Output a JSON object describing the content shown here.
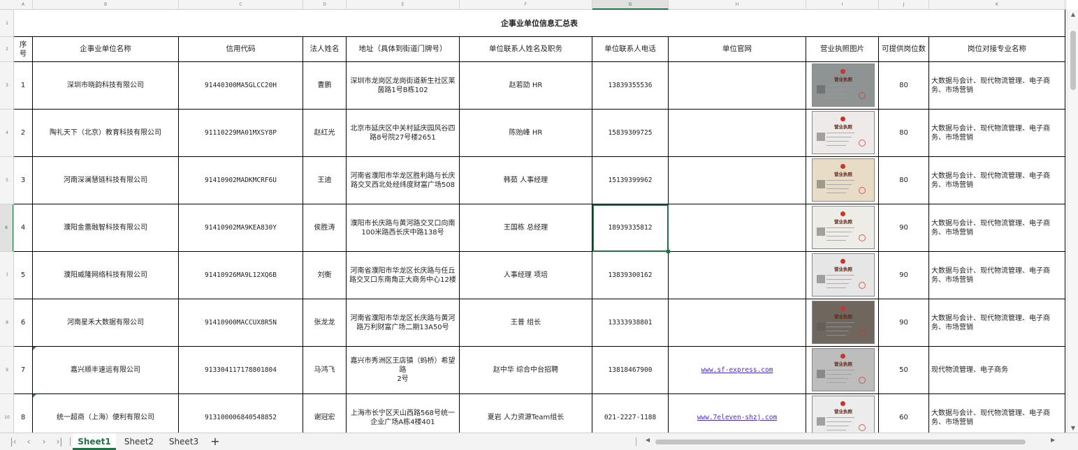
{
  "columns": [
    "A",
    "B",
    "C",
    "D",
    "E",
    "F",
    "G",
    "H",
    "I",
    "J",
    "K"
  ],
  "selected_column": "G",
  "selected_row": "6",
  "title": "企事业单位信息汇总表",
  "headers": [
    "序号",
    "企事业单位名称",
    "信用代码",
    "法人姓名",
    "地址（具体到街道门牌号）",
    "单位联系人姓名及职务",
    "单位联系人电话",
    "单位官网",
    "营业执照图片",
    "可提供岗位数",
    "岗位对接专业名称"
  ],
  "rows": [
    {
      "row": "3",
      "no": "1",
      "name": "深圳市晓韵科技有限公司",
      "code": "91440300MA5GLCC20H",
      "legal": "曹鹏",
      "address": "深圳市龙岗区龙岗街道新生社区莱茵路1号B栋102",
      "contact": "赵若劭  HR",
      "phone": "13839355536",
      "site": "",
      "license_caption": "营业执照",
      "jobs": "80",
      "majors": "大数据与会计、现代物流管理、电子商务、市场营销"
    },
    {
      "row": "4",
      "no": "2",
      "name": "陶礼天下（北京）教育科技有限公司",
      "code": "91110229MA01MXSY8P",
      "legal": "赵红光",
      "address": "北京市延庆区中关村延庆园风谷四路8号院27号楼2651",
      "contact": "陈贻峰  HR",
      "phone": "15839309725",
      "site": "",
      "license_caption": "营业执照",
      "jobs": "80",
      "majors": "大数据与会计、现代物流管理、电子商务、市场营销"
    },
    {
      "row": "5",
      "no": "3",
      "name": "河南深澜慧链科技有限公司",
      "code": "91410902MADKMCRF6U",
      "legal": "王迪",
      "address": "河南省濮阳市华龙区胜利路与长庆路交叉西北处经纬度财富广场508",
      "contact": "韩茹  人事经理",
      "phone": "15139399962",
      "site": "",
      "license_caption": "营业执照",
      "jobs": "80",
      "majors": "大数据与会计、现代物流管理、电子商务、市场营销"
    },
    {
      "row": "6",
      "no": "4",
      "name": "濮阳金蕾融智科技有限公司",
      "code": "91410902MA9KEA830Y",
      "legal": "侯胜涛",
      "address": "濮阳市长庆路与黄河路交叉口向南100米路西长庆中路138号",
      "contact": "王国栋  总经理",
      "phone": "18939335812",
      "site": "",
      "license_caption": "营业执照",
      "jobs": "90",
      "majors": "大数据与会计、现代物流管理、电子商务、市场营销"
    },
    {
      "row": "7",
      "no": "5",
      "name": "濮阳威隆网络科技有限公司",
      "code": "91410926MA9L12XQ6B",
      "legal": "刘衡",
      "address": "河南省濮阳市华龙区长庆路与任丘路交叉口东南角正大商务中心12楼",
      "contact": "人事经理  项培",
      "phone": "13839300162",
      "site": "",
      "license_caption": "营业执照",
      "jobs": "90",
      "majors": "大数据与会计、现代物流管理、电子商务、市场营销"
    },
    {
      "row": "8",
      "no": "6",
      "name": "河南星禾大数据有限公司",
      "code": "91410900MACCUX8R5N",
      "legal": "张龙龙",
      "address": "河南省濮阳市华龙区长庆路与黄河路万利财富广场二期13A50号",
      "contact": "王普  组长",
      "phone": "13333938801",
      "site": "",
      "license_caption": "营业执照",
      "jobs": "90",
      "majors": "大数据与会计、现代物流管理、电子商务、市场营销"
    },
    {
      "row": "9",
      "no": "7",
      "name": "嘉兴顺丰速运有限公司",
      "code": "913304117178801804",
      "legal": "马鸿飞",
      "address": "嘉兴市秀洲区王店镇（蚂桥）希望路\n2号",
      "contact": "赵中华  综合中台招聘",
      "phone": "13818467900",
      "site": "www.sf-express.com",
      "license_caption": "营业执照",
      "jobs": "50",
      "majors": "现代物流管理、电子商务"
    },
    {
      "row": "10",
      "no": "8",
      "name": "统一超商（上海）便利有限公司",
      "code": "91310000684054885​2",
      "legal": "谢冠宏",
      "address": "上海市长宁区天山西路568号统一企业广场A栋4楼401",
      "contact": "夏岩  人力资源Team组长",
      "phone": "021-2227-1188",
      "site": "www.7eleven-shzj.com",
      "license_caption": "营业执照",
      "jobs": "60",
      "majors": "大数据与会计、现代物流管理、电子商务、市场营销"
    }
  ],
  "sheets": [
    "Sheet1",
    "Sheet2",
    "Sheet3"
  ],
  "active_sheet": "Sheet1",
  "icons": [
    "first-sheet-icon",
    "prev-sheet-icon",
    "next-sheet-icon",
    "last-sheet-icon",
    "add-sheet-icon"
  ],
  "colors": {
    "accent": "#217346",
    "link": "#4b2bbd",
    "seal": "#c8352b"
  }
}
